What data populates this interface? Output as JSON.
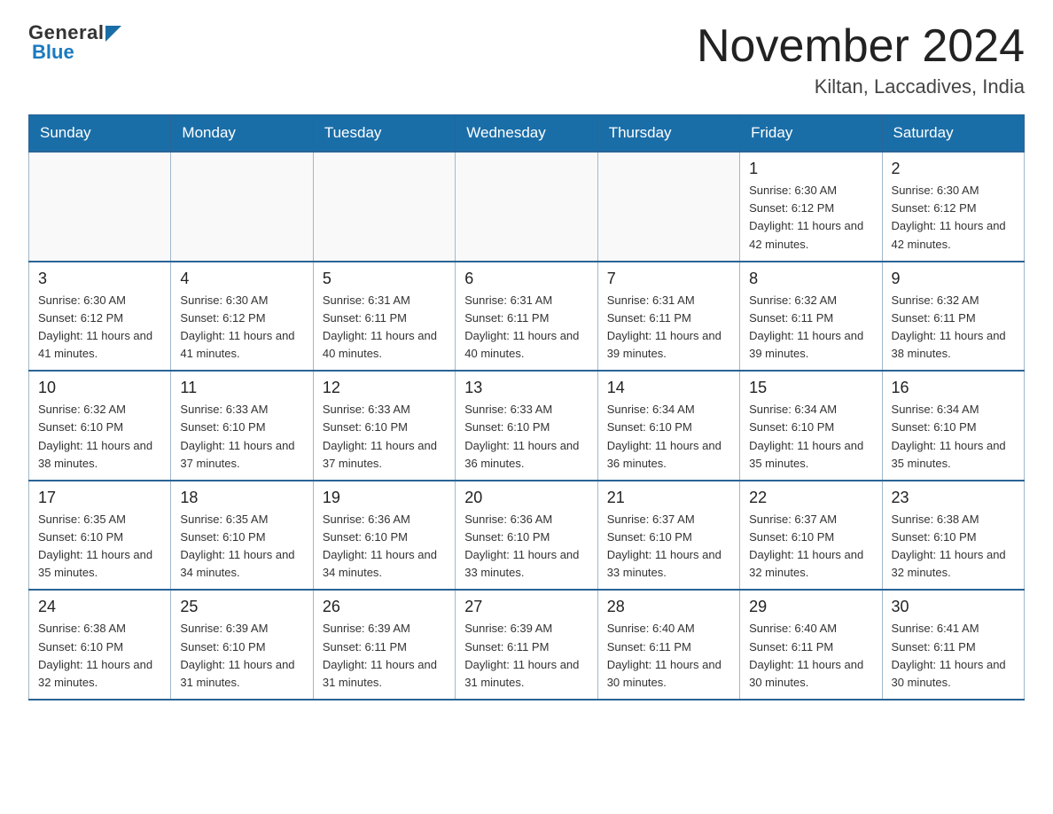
{
  "header": {
    "logo_top": "General",
    "logo_bottom": "Blue",
    "title": "November 2024",
    "subtitle": "Kiltan, Laccadives, India"
  },
  "days_of_week": [
    "Sunday",
    "Monday",
    "Tuesday",
    "Wednesday",
    "Thursday",
    "Friday",
    "Saturday"
  ],
  "weeks": [
    [
      {
        "day": "",
        "info": ""
      },
      {
        "day": "",
        "info": ""
      },
      {
        "day": "",
        "info": ""
      },
      {
        "day": "",
        "info": ""
      },
      {
        "day": "",
        "info": ""
      },
      {
        "day": "1",
        "info": "Sunrise: 6:30 AM\nSunset: 6:12 PM\nDaylight: 11 hours and 42 minutes."
      },
      {
        "day": "2",
        "info": "Sunrise: 6:30 AM\nSunset: 6:12 PM\nDaylight: 11 hours and 42 minutes."
      }
    ],
    [
      {
        "day": "3",
        "info": "Sunrise: 6:30 AM\nSunset: 6:12 PM\nDaylight: 11 hours and 41 minutes."
      },
      {
        "day": "4",
        "info": "Sunrise: 6:30 AM\nSunset: 6:12 PM\nDaylight: 11 hours and 41 minutes."
      },
      {
        "day": "5",
        "info": "Sunrise: 6:31 AM\nSunset: 6:11 PM\nDaylight: 11 hours and 40 minutes."
      },
      {
        "day": "6",
        "info": "Sunrise: 6:31 AM\nSunset: 6:11 PM\nDaylight: 11 hours and 40 minutes."
      },
      {
        "day": "7",
        "info": "Sunrise: 6:31 AM\nSunset: 6:11 PM\nDaylight: 11 hours and 39 minutes."
      },
      {
        "day": "8",
        "info": "Sunrise: 6:32 AM\nSunset: 6:11 PM\nDaylight: 11 hours and 39 minutes."
      },
      {
        "day": "9",
        "info": "Sunrise: 6:32 AM\nSunset: 6:11 PM\nDaylight: 11 hours and 38 minutes."
      }
    ],
    [
      {
        "day": "10",
        "info": "Sunrise: 6:32 AM\nSunset: 6:10 PM\nDaylight: 11 hours and 38 minutes."
      },
      {
        "day": "11",
        "info": "Sunrise: 6:33 AM\nSunset: 6:10 PM\nDaylight: 11 hours and 37 minutes."
      },
      {
        "day": "12",
        "info": "Sunrise: 6:33 AM\nSunset: 6:10 PM\nDaylight: 11 hours and 37 minutes."
      },
      {
        "day": "13",
        "info": "Sunrise: 6:33 AM\nSunset: 6:10 PM\nDaylight: 11 hours and 36 minutes."
      },
      {
        "day": "14",
        "info": "Sunrise: 6:34 AM\nSunset: 6:10 PM\nDaylight: 11 hours and 36 minutes."
      },
      {
        "day": "15",
        "info": "Sunrise: 6:34 AM\nSunset: 6:10 PM\nDaylight: 11 hours and 35 minutes."
      },
      {
        "day": "16",
        "info": "Sunrise: 6:34 AM\nSunset: 6:10 PM\nDaylight: 11 hours and 35 minutes."
      }
    ],
    [
      {
        "day": "17",
        "info": "Sunrise: 6:35 AM\nSunset: 6:10 PM\nDaylight: 11 hours and 35 minutes."
      },
      {
        "day": "18",
        "info": "Sunrise: 6:35 AM\nSunset: 6:10 PM\nDaylight: 11 hours and 34 minutes."
      },
      {
        "day": "19",
        "info": "Sunrise: 6:36 AM\nSunset: 6:10 PM\nDaylight: 11 hours and 34 minutes."
      },
      {
        "day": "20",
        "info": "Sunrise: 6:36 AM\nSunset: 6:10 PM\nDaylight: 11 hours and 33 minutes."
      },
      {
        "day": "21",
        "info": "Sunrise: 6:37 AM\nSunset: 6:10 PM\nDaylight: 11 hours and 33 minutes."
      },
      {
        "day": "22",
        "info": "Sunrise: 6:37 AM\nSunset: 6:10 PM\nDaylight: 11 hours and 32 minutes."
      },
      {
        "day": "23",
        "info": "Sunrise: 6:38 AM\nSunset: 6:10 PM\nDaylight: 11 hours and 32 minutes."
      }
    ],
    [
      {
        "day": "24",
        "info": "Sunrise: 6:38 AM\nSunset: 6:10 PM\nDaylight: 11 hours and 32 minutes."
      },
      {
        "day": "25",
        "info": "Sunrise: 6:39 AM\nSunset: 6:10 PM\nDaylight: 11 hours and 31 minutes."
      },
      {
        "day": "26",
        "info": "Sunrise: 6:39 AM\nSunset: 6:11 PM\nDaylight: 11 hours and 31 minutes."
      },
      {
        "day": "27",
        "info": "Sunrise: 6:39 AM\nSunset: 6:11 PM\nDaylight: 11 hours and 31 minutes."
      },
      {
        "day": "28",
        "info": "Sunrise: 6:40 AM\nSunset: 6:11 PM\nDaylight: 11 hours and 30 minutes."
      },
      {
        "day": "29",
        "info": "Sunrise: 6:40 AM\nSunset: 6:11 PM\nDaylight: 11 hours and 30 minutes."
      },
      {
        "day": "30",
        "info": "Sunrise: 6:41 AM\nSunset: 6:11 PM\nDaylight: 11 hours and 30 minutes."
      }
    ]
  ]
}
